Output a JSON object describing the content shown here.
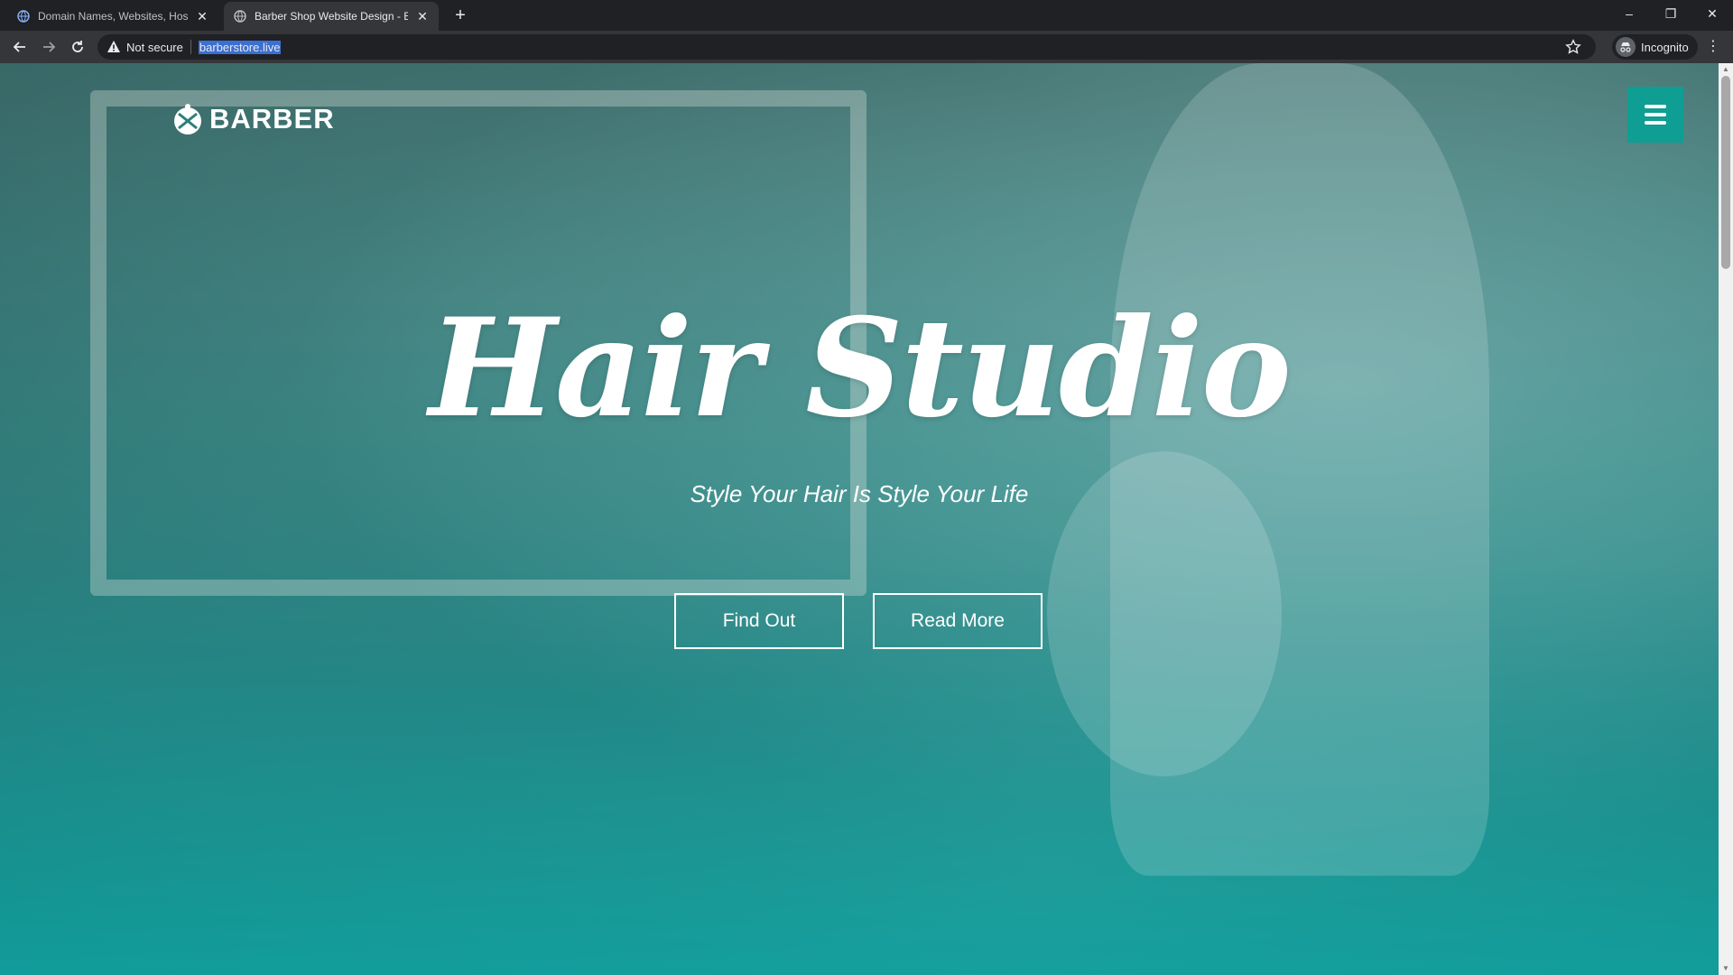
{
  "browser": {
    "tabs": [
      {
        "title": "Domain Names, Websites, Hosti",
        "active": false
      },
      {
        "title": "Barber Shop Website Design - E",
        "active": true
      }
    ],
    "new_tab_label": "+",
    "window_controls": {
      "minimize": "–",
      "maximize": "❐",
      "close": "✕"
    },
    "security_label": "Not secure",
    "url": "barberstore.live",
    "profile_label": "Incognito",
    "menu_label": "⋮"
  },
  "site": {
    "brand": "BARBER",
    "hero": {
      "title": "Hair Studio",
      "tagline": "Style Your Hair Is Style Your Life",
      "buttons": [
        {
          "label": "Find Out"
        },
        {
          "label": "Read More"
        }
      ]
    },
    "accent_color": "#0e9e94"
  },
  "icons": [
    "globe-icon",
    "warning-icon",
    "back-arrow-icon",
    "forward-arrow-icon",
    "reload-icon",
    "star-icon",
    "incognito-icon",
    "hamburger-icon",
    "barber-logo-icon"
  ]
}
